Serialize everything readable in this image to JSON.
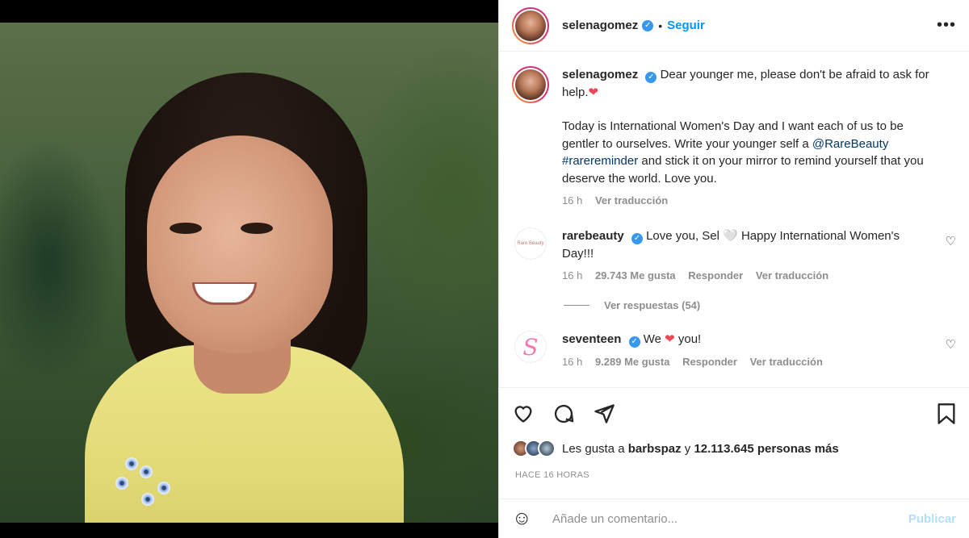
{
  "post": {
    "username": "selenagomez",
    "verified_mark": "✓",
    "dot": "•",
    "follow_label": "Seguir",
    "more_label": "•••"
  },
  "caption": {
    "username": "selenagomez",
    "line1": "Dear younger me, please don't be afraid to ask for help.",
    "heart": "❤",
    "para2_a": "Today is International Women's Day and I want each of us to be gentler to ourselves. Write your younger self a ",
    "mention": "@RareBeauty",
    "hashtag": "#rarereminder",
    "para2_b": " and stick it on your mirror to remind yourself that you deserve the world. Love you.",
    "time": "16 h",
    "translate": "Ver traducción"
  },
  "comments": [
    {
      "username": "rarebeauty",
      "avatar_text": "Rare Beauty",
      "text": "Love you, Sel 🤍 Happy International Women's Day!!!",
      "time": "16 h",
      "likes": "29.743 Me gusta",
      "reply": "Responder",
      "translate": "Ver traducción",
      "view_replies": "Ver respuestas (54)"
    },
    {
      "username": "seventeen",
      "avatar_text": "S",
      "text_a": "We",
      "heart": "❤",
      "text_b": "you!",
      "time": "16 h",
      "likes": "9.289 Me gusta",
      "reply": "Responder",
      "translate": "Ver traducción"
    }
  ],
  "likes_row": {
    "prefix": "Les gusta a",
    "user": "barbspaz",
    "middle": "y",
    "count": "12.113.645 personas más"
  },
  "time_label": "HACE 16 HORAS",
  "comment_box": {
    "emoji": "☺",
    "placeholder": "Añade un comentario...",
    "post_label": "Publicar"
  },
  "colors": {
    "accent": "#0095f6",
    "verified": "#3897f0",
    "heart": "#ed4956",
    "post_disabled": "#b2dffc"
  }
}
